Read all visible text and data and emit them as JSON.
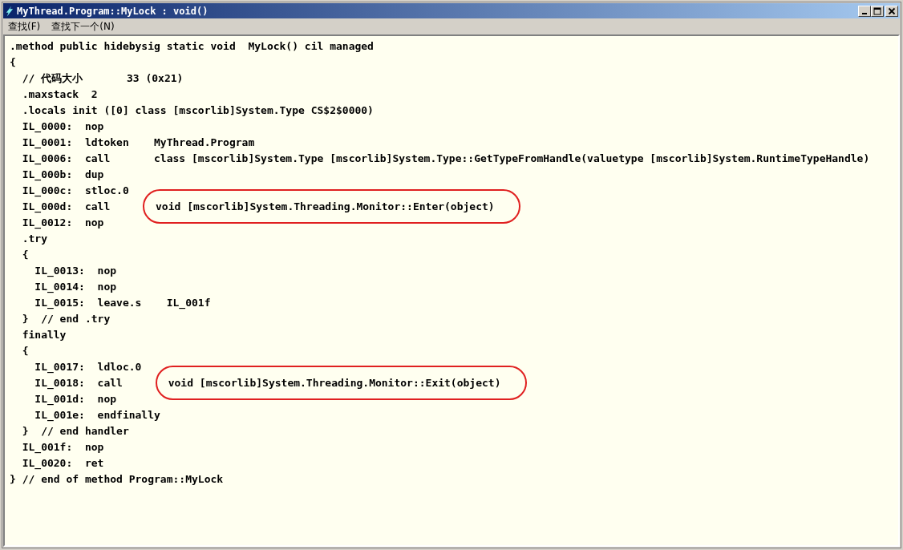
{
  "window": {
    "title": "MyThread.Program::MyLock : void()"
  },
  "menu": [
    {
      "label": "查找(F)"
    },
    {
      "label": "查找下一个(N)"
    }
  ],
  "code_lines": [
    {
      "text": ".method public hidebysig static void  MyLock() cil managed"
    },
    {
      "text": "{"
    },
    {
      "text": "  // 代码大小       33 (0x21)"
    },
    {
      "text": "  .maxstack  2"
    },
    {
      "text": "  .locals init ([0] class [mscorlib]System.Type CS$2$0000)"
    },
    {
      "text": "  IL_0000:  nop"
    },
    {
      "text": "  IL_0001:  ldtoken    MyThread.Program"
    },
    {
      "text": "  IL_0006:  call       class [mscorlib]System.Type [mscorlib]System.Type::GetTypeFromHandle(valuetype [mscorlib]System.RuntimeTypeHandle)"
    },
    {
      "text": "  IL_000b:  dup"
    },
    {
      "text": "  IL_000c:  stloc.0"
    },
    {
      "text": "  IL_000d:  call       ",
      "operand": "void [mscorlib]System.Threading.Monitor::Enter(object)",
      "circled": true
    },
    {
      "text": "  IL_0012:  nop"
    },
    {
      "text": "  .try"
    },
    {
      "text": "  {"
    },
    {
      "text": "    IL_0013:  nop"
    },
    {
      "text": "    IL_0014:  nop"
    },
    {
      "text": "    IL_0015:  leave.s    IL_001f"
    },
    {
      "text": "  }  // end .try"
    },
    {
      "text": "  finally"
    },
    {
      "text": "  {"
    },
    {
      "text": "    IL_0017:  ldloc.0"
    },
    {
      "text": "    IL_0018:  call       ",
      "operand": "void [mscorlib]System.Threading.Monitor::Exit(object)",
      "circled": true
    },
    {
      "text": "    IL_001d:  nop"
    },
    {
      "text": "    IL_001e:  endfinally"
    },
    {
      "text": "  }  // end handler"
    },
    {
      "text": "  IL_001f:  nop"
    },
    {
      "text": "  IL_0020:  ret"
    },
    {
      "text": "} // end of method Program::MyLock"
    }
  ]
}
